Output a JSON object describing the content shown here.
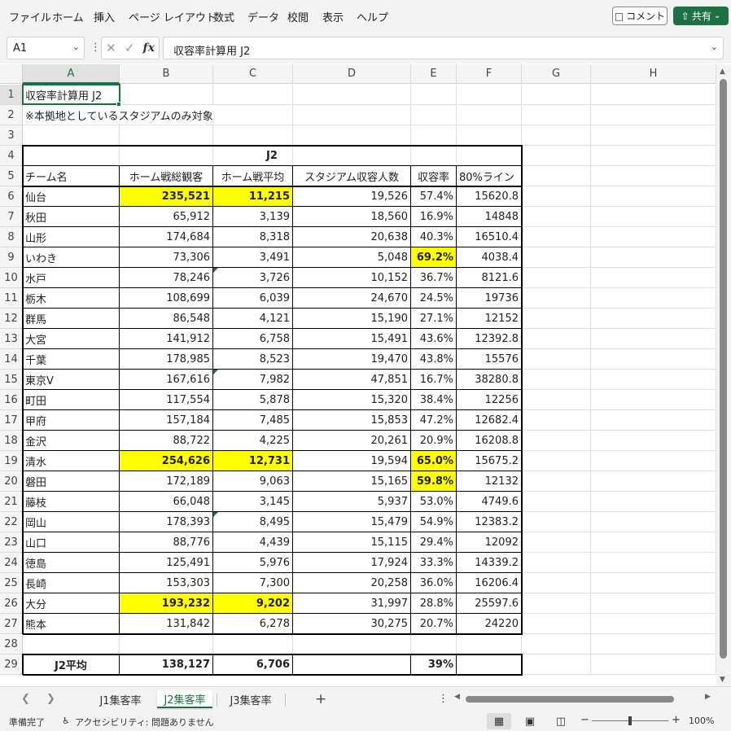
{
  "ribbon": {
    "menu": [
      "ファイル",
      "ホーム",
      "挿入",
      "ページ レイアウト",
      "数式",
      "データ",
      "校閲",
      "表示",
      "ヘルプ"
    ],
    "comment_label": "コメント",
    "share_label": "共有"
  },
  "formula_bar": {
    "name_box": "A1",
    "content": "収容率計算用 J2"
  },
  "columns": [
    "A",
    "B",
    "C",
    "D",
    "E",
    "F",
    "G",
    "H"
  ],
  "rows": [
    "1",
    "2",
    "3",
    "4",
    "5",
    "6",
    "7",
    "8",
    "9",
    "10",
    "11",
    "12",
    "13",
    "14",
    "15",
    "16",
    "17",
    "18",
    "19",
    "20",
    "21",
    "22",
    "23",
    "24",
    "25",
    "26",
    "27",
    "28",
    "29"
  ],
  "sheet": {
    "title": "収容率計算用 J2",
    "note": "※本拠地としているスタジアムのみ対象",
    "table_title": "J2",
    "headers": [
      "チーム名",
      "ホーム戦総観客",
      "ホーム戦平均",
      "スタジアム収容人数",
      "収容率",
      "80%ライン"
    ],
    "rows": [
      {
        "team": "仙台",
        "total": "235,521",
        "avg": "11,215",
        "capacity": "19,526",
        "rate": "57.4%",
        "line80": "15620.8",
        "hl_total": true,
        "hl_avg": true,
        "hl_rate": false,
        "tri_b": false,
        "tri_c": false
      },
      {
        "team": "秋田",
        "total": "65,912",
        "avg": "3,139",
        "capacity": "18,560",
        "rate": "16.9%",
        "line80": "14848",
        "hl_total": false,
        "hl_avg": false,
        "hl_rate": false,
        "tri_b": false,
        "tri_c": false
      },
      {
        "team": "山形",
        "total": "174,684",
        "avg": "8,318",
        "capacity": "20,638",
        "rate": "40.3%",
        "line80": "16510.4",
        "hl_total": false,
        "hl_avg": false,
        "hl_rate": false,
        "tri_b": false,
        "tri_c": false
      },
      {
        "team": "いわき",
        "total": "73,306",
        "avg": "3,491",
        "capacity": "5,048",
        "rate": "69.2%",
        "line80": "4038.4",
        "hl_total": false,
        "hl_avg": false,
        "hl_rate": true,
        "tri_b": false,
        "tri_c": false
      },
      {
        "team": "水戸",
        "total": "78,246",
        "avg": "3,726",
        "capacity": "10,152",
        "rate": "36.7%",
        "line80": "8121.6",
        "hl_total": false,
        "hl_avg": false,
        "hl_rate": false,
        "tri_b": false,
        "tri_c": true
      },
      {
        "team": "栃木",
        "total": "108,699",
        "avg": "6,039",
        "capacity": "24,670",
        "rate": "24.5%",
        "line80": "19736",
        "hl_total": false,
        "hl_avg": false,
        "hl_rate": false,
        "tri_b": false,
        "tri_c": false
      },
      {
        "team": "群馬",
        "total": "86,548",
        "avg": "4,121",
        "capacity": "15,190",
        "rate": "27.1%",
        "line80": "12152",
        "hl_total": false,
        "hl_avg": false,
        "hl_rate": false,
        "tri_b": false,
        "tri_c": false
      },
      {
        "team": "大宮",
        "total": "141,912",
        "avg": "6,758",
        "capacity": "15,491",
        "rate": "43.6%",
        "line80": "12392.8",
        "hl_total": false,
        "hl_avg": false,
        "hl_rate": false,
        "tri_b": false,
        "tri_c": false
      },
      {
        "team": "千葉",
        "total": "178,985",
        "avg": "8,523",
        "capacity": "19,470",
        "rate": "43.8%",
        "line80": "15576",
        "hl_total": false,
        "hl_avg": false,
        "hl_rate": false,
        "tri_b": false,
        "tri_c": false
      },
      {
        "team": "東京V",
        "total": "167,616",
        "avg": "7,982",
        "capacity": "47,851",
        "rate": "16.7%",
        "line80": "38280.8",
        "hl_total": false,
        "hl_avg": false,
        "hl_rate": false,
        "tri_b": false,
        "tri_c": true
      },
      {
        "team": "町田",
        "total": "117,554",
        "avg": "5,878",
        "capacity": "15,320",
        "rate": "38.4%",
        "line80": "12256",
        "hl_total": false,
        "hl_avg": false,
        "hl_rate": false,
        "tri_b": false,
        "tri_c": false
      },
      {
        "team": "甲府",
        "total": "157,184",
        "avg": "7,485",
        "capacity": "15,853",
        "rate": "47.2%",
        "line80": "12682.4",
        "hl_total": false,
        "hl_avg": false,
        "hl_rate": false,
        "tri_b": false,
        "tri_c": false
      },
      {
        "team": "金沢",
        "total": "88,722",
        "avg": "4,225",
        "capacity": "20,261",
        "rate": "20.9%",
        "line80": "16208.8",
        "hl_total": false,
        "hl_avg": false,
        "hl_rate": false,
        "tri_b": false,
        "tri_c": false
      },
      {
        "team": "清水",
        "total": "254,626",
        "avg": "12,731",
        "capacity": "19,594",
        "rate": "65.0%",
        "line80": "15675.2",
        "hl_total": true,
        "hl_avg": true,
        "hl_rate": true,
        "tri_b": false,
        "tri_c": false
      },
      {
        "team": "磐田",
        "total": "172,189",
        "avg": "9,063",
        "capacity": "15,165",
        "rate": "59.8%",
        "line80": "12132",
        "hl_total": false,
        "hl_avg": false,
        "hl_rate": true,
        "tri_b": false,
        "tri_c": false
      },
      {
        "team": "藤枝",
        "total": "66,048",
        "avg": "3,145",
        "capacity": "5,937",
        "rate": "53.0%",
        "line80": "4749.6",
        "hl_total": false,
        "hl_avg": false,
        "hl_rate": false,
        "tri_b": false,
        "tri_c": false
      },
      {
        "team": "岡山",
        "total": "178,393",
        "avg": "8,495",
        "capacity": "15,479",
        "rate": "54.9%",
        "line80": "12383.2",
        "hl_total": false,
        "hl_avg": false,
        "hl_rate": false,
        "tri_b": false,
        "tri_c": true
      },
      {
        "team": "山口",
        "total": "88,776",
        "avg": "4,439",
        "capacity": "15,115",
        "rate": "29.4%",
        "line80": "12092",
        "hl_total": false,
        "hl_avg": false,
        "hl_rate": false,
        "tri_b": false,
        "tri_c": false
      },
      {
        "team": "徳島",
        "total": "125,491",
        "avg": "5,976",
        "capacity": "17,924",
        "rate": "33.3%",
        "line80": "14339.2",
        "hl_total": false,
        "hl_avg": false,
        "hl_rate": false,
        "tri_b": false,
        "tri_c": false
      },
      {
        "team": "長崎",
        "total": "153,303",
        "avg": "7,300",
        "capacity": "20,258",
        "rate": "36.0%",
        "line80": "16206.4",
        "hl_total": false,
        "hl_avg": false,
        "hl_rate": false,
        "tri_b": false,
        "tri_c": false
      },
      {
        "team": "大分",
        "total": "193,232",
        "avg": "9,202",
        "capacity": "31,997",
        "rate": "28.8%",
        "line80": "25597.6",
        "hl_total": true,
        "hl_avg": true,
        "hl_rate": false,
        "tri_b": false,
        "tri_c": false
      },
      {
        "team": "熊本",
        "total": "131,842",
        "avg": "6,278",
        "capacity": "30,275",
        "rate": "20.7%",
        "line80": "24220",
        "hl_total": false,
        "hl_avg": false,
        "hl_rate": false,
        "tri_b": false,
        "tri_c": false
      }
    ],
    "avg_row": {
      "label": "J2平均",
      "total": "138,127",
      "avg": "6,706",
      "rate": "39%"
    }
  },
  "sheet_tabs": [
    "J1集客率",
    "J2集客率",
    "J3集客率"
  ],
  "active_tab": "J2集客率",
  "status": {
    "ready": "準備完了",
    "accessibility": "アクセシビリティ: 問題ありません",
    "zoom": "100%"
  },
  "colors": {
    "accent": "#1e7145",
    "highlight": "#ffff00"
  }
}
